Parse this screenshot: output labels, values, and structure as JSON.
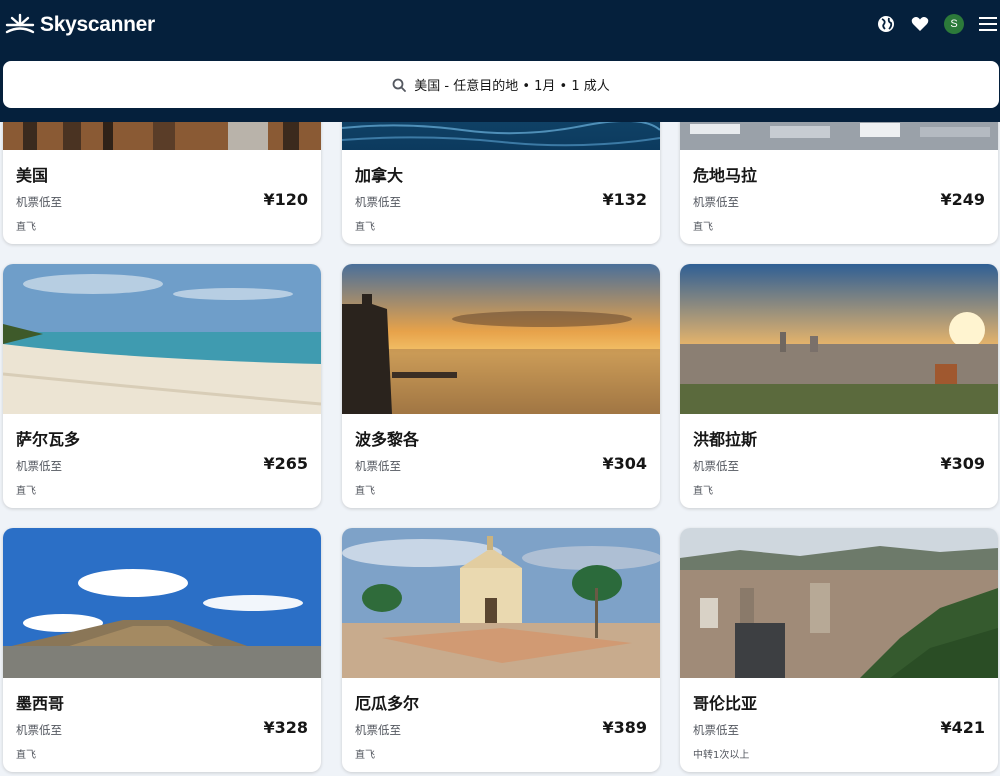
{
  "header": {
    "brand": "Skyscanner",
    "avatar_initial": "S",
    "icons": [
      "globe-icon",
      "heart-icon",
      "avatar",
      "menu-icon"
    ]
  },
  "search": {
    "summary": "美国 - 任意目的地 • 1月 • 1 成人"
  },
  "labels": {
    "from": "机票低至"
  },
  "colors": {
    "header_bg": "#05203c",
    "page_bg": "#eff3f8",
    "avatar_bg": "#2c7a3a"
  },
  "destinations": [
    {
      "name": "美国",
      "price": "¥120",
      "stops": "直飞"
    },
    {
      "name": "加拿大",
      "price": "¥132",
      "stops": "直飞"
    },
    {
      "name": "危地马拉",
      "price": "¥249",
      "stops": "直飞"
    },
    {
      "name": "萨尔瓦多",
      "price": "¥265",
      "stops": "直飞"
    },
    {
      "name": "波多黎各",
      "price": "¥304",
      "stops": "直飞"
    },
    {
      "name": "洪都拉斯",
      "price": "¥309",
      "stops": "直飞"
    },
    {
      "name": "墨西哥",
      "price": "¥328",
      "stops": "直飞"
    },
    {
      "name": "厄瓜多尔",
      "price": "¥389",
      "stops": "直飞"
    },
    {
      "name": "哥伦比亚",
      "price": "¥421",
      "stops": "中转1次以上"
    }
  ]
}
